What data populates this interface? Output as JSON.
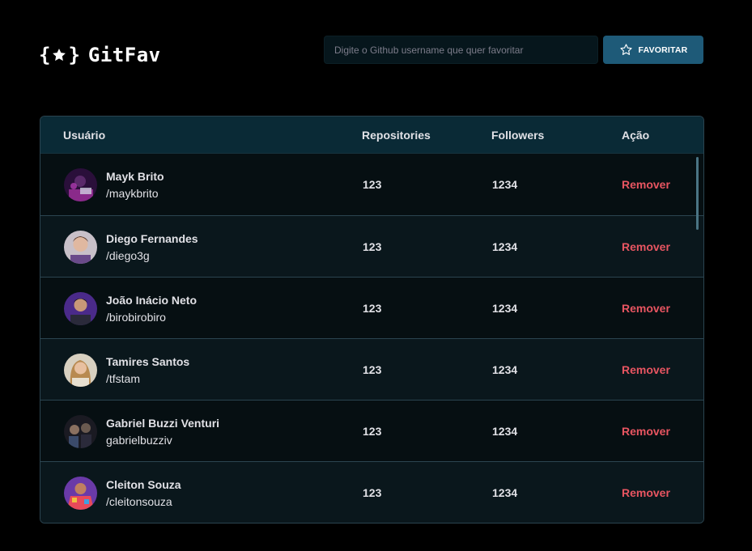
{
  "app": {
    "title": "GitFav"
  },
  "search": {
    "placeholder": "Digite o Github username que quer favoritar",
    "value": ""
  },
  "toolbar": {
    "favorite_label": "FAVORITAR"
  },
  "table": {
    "headers": {
      "user": "Usuário",
      "repositories": "Repositories",
      "followers": "Followers",
      "action": "Ação"
    },
    "rows": [
      {
        "name": "Mayk Brito",
        "login": "/maykbrito",
        "repositories": "123",
        "followers": "1234",
        "action": "Remover"
      },
      {
        "name": "Diego Fernandes",
        "login": "/diego3g",
        "repositories": "123",
        "followers": "1234",
        "action": "Remover"
      },
      {
        "name": "João Inácio Neto",
        "login": "/birobirobiro",
        "repositories": "123",
        "followers": "1234",
        "action": "Remover"
      },
      {
        "name": "Tamires Santos",
        "login": "/tfstam",
        "repositories": "123",
        "followers": "1234",
        "action": "Remover"
      },
      {
        "name": "Gabriel Buzzi Venturi",
        "login": "gabrielbuzziv",
        "repositories": "123",
        "followers": "1234",
        "action": "Remover"
      },
      {
        "name": "Cleiton Souza",
        "login": "/cleitonsouza",
        "repositories": "123",
        "followers": "1234",
        "action": "Remover"
      }
    ]
  },
  "colors": {
    "accent": "#1e5a78",
    "danger": "#e85561",
    "background": "#000000",
    "header": "#0a2a36"
  },
  "icons": {
    "logo": "star-braces-icon",
    "favorite": "star-outline-icon",
    "avatar": "user-avatar"
  }
}
